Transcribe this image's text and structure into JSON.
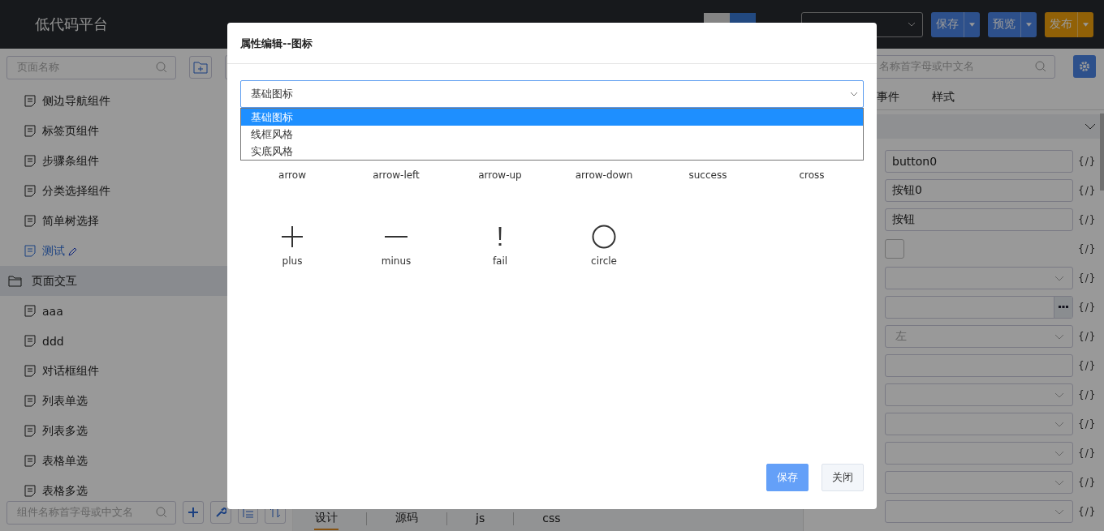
{
  "header": {
    "logo": "低代码平台",
    "mode_switch": [
      {
        "selected": false
      },
      {
        "selected": true
      }
    ],
    "actions": [
      {
        "label": "保存",
        "kind": "primary"
      },
      {
        "label": "预览",
        "kind": "primary"
      },
      {
        "label": "发布",
        "kind": "warning"
      }
    ]
  },
  "sidebar": {
    "search": {
      "placeholder": "页面名称"
    },
    "pages": [
      {
        "label": "侧边导航组件",
        "selected": false
      },
      {
        "label": "标签页组件",
        "selected": false
      },
      {
        "label": "步骤条组件",
        "selected": false
      },
      {
        "label": "分类选择组件",
        "selected": false
      },
      {
        "label": "简单树选择",
        "selected": false
      },
      {
        "label": "测试",
        "selected": true
      }
    ],
    "folder": {
      "label": "页面交互",
      "highlighted": true,
      "children": [
        {
          "label": "aaa",
          "selected": false
        },
        {
          "label": "ddd",
          "selected": false
        },
        {
          "label": "对话框组件",
          "selected": false
        },
        {
          "label": "列表单选",
          "selected": false
        },
        {
          "label": "列表多选",
          "selected": false
        },
        {
          "label": "表格单选",
          "selected": false
        },
        {
          "label": "表格多选",
          "selected": false
        }
      ]
    },
    "component_search": {
      "placeholder": "组件名称首字母或中文名"
    }
  },
  "editor_tabs": [
    {
      "label": "设计",
      "selected": true
    },
    {
      "label": "源码",
      "selected": false
    },
    {
      "label": "js",
      "selected": false
    },
    {
      "label": "css",
      "selected": false
    }
  ],
  "properties": {
    "search": {
      "placeholder": "名称首字母或中文名"
    },
    "tabs": [
      {
        "label": "事件",
        "selected": false
      },
      {
        "label": "样式",
        "selected": false
      }
    ],
    "binding_mark": "{/}",
    "rows": [
      {
        "kind": "input",
        "value": "button0"
      },
      {
        "kind": "input",
        "value": "按钮0"
      },
      {
        "kind": "input",
        "value": "按钮"
      },
      {
        "kind": "checkbox",
        "checked": false
      },
      {
        "kind": "select"
      },
      {
        "kind": "picker"
      },
      {
        "kind": "select",
        "placeholder": "左"
      },
      {
        "kind": "input"
      },
      {
        "kind": "select"
      },
      {
        "kind": "select"
      },
      {
        "kind": "select"
      },
      {
        "kind": "select"
      },
      {
        "kind": "select"
      }
    ]
  },
  "dialog": {
    "title": "属性编辑--图标",
    "select": {
      "value": "基础图标",
      "options": [
        {
          "label": "基础图标",
          "selected": true
        },
        {
          "label": "线框风格",
          "selected": false
        },
        {
          "label": "实底风格",
          "selected": false
        }
      ]
    },
    "icons": [
      {
        "label": "arrow"
      },
      {
        "label": "arrow-left"
      },
      {
        "label": "arrow-up"
      },
      {
        "label": "arrow-down"
      },
      {
        "label": "success"
      },
      {
        "label": "cross"
      },
      {
        "label": "plus",
        "kind": "plus"
      },
      {
        "label": "minus",
        "kind": "minus"
      },
      {
        "label": "fail",
        "kind": "fail"
      },
      {
        "label": "circle",
        "kind": "circle"
      }
    ],
    "buttons": [
      {
        "label": "保存",
        "kind": "primary"
      },
      {
        "label": "关闭",
        "kind": "default"
      }
    ]
  }
}
